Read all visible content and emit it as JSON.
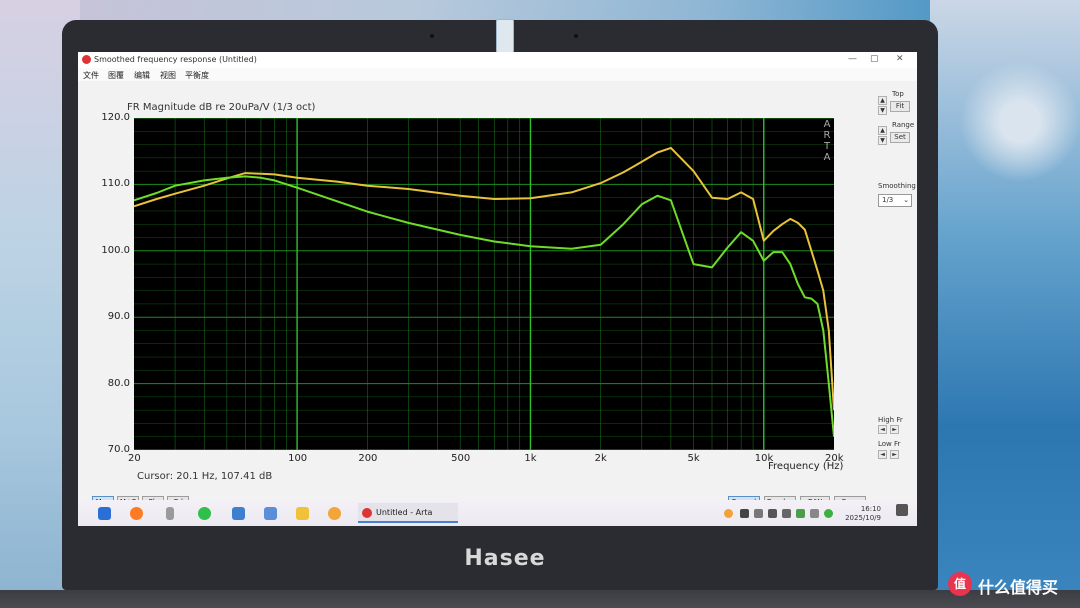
{
  "window": {
    "title": "Smoothed frequency response (Untitled)",
    "minimize_glyph": "—",
    "maximize_glyph": "▢",
    "close_glyph": "✕"
  },
  "menu": [
    "文件",
    "图覆",
    "编辑",
    "视图",
    "平衡度"
  ],
  "chart_data": {
    "type": "line",
    "title": "FR Magnitude dB re 20uPa/V (1/3 oct)",
    "xlabel": "Frequency (Hz)",
    "ylabel": "",
    "x_scale": "log",
    "xlim": [
      20,
      20000
    ],
    "ylim": [
      70,
      120
    ],
    "grid": true,
    "background": "#000000",
    "grid_color": "#1f8c1f",
    "x_tick_labels": [
      "20",
      "100",
      "200",
      "500",
      "1k",
      "2k",
      "5k",
      "10k",
      "20k"
    ],
    "x_tick_values": [
      20,
      100,
      200,
      500,
      1000,
      2000,
      5000,
      10000,
      20000
    ],
    "y_tick_labels": [
      "120.0",
      "110.0",
      "100.0",
      "90.0",
      "80.0",
      "70.0"
    ],
    "y_tick_values": [
      120,
      110,
      100,
      90,
      80,
      70
    ],
    "series": [
      {
        "color": "#e8c23a",
        "x": [
          20,
          25,
          30,
          40,
          50,
          60,
          70,
          80,
          100,
          150,
          200,
          300,
          500,
          700,
          1000,
          1500,
          2000,
          2500,
          3000,
          3500,
          4000,
          5000,
          6000,
          7000,
          8000,
          9000,
          10000,
          11000,
          12000,
          13000,
          14000,
          15000,
          16000,
          17000,
          18000,
          19000,
          20000
        ],
        "y": [
          106.7,
          107.8,
          108.6,
          109.8,
          110.9,
          111.7,
          111.6,
          111.5,
          111.0,
          110.4,
          109.8,
          109.3,
          108.3,
          107.8,
          107.9,
          108.8,
          110.2,
          111.8,
          113.4,
          114.8,
          115.5,
          112.0,
          108.0,
          107.8,
          108.8,
          107.8,
          101.5,
          103.0,
          104.0,
          104.8,
          104.2,
          103.2,
          100.0,
          97.0,
          94.0,
          88.0,
          76.0
        ]
      },
      {
        "color": "#6fdc2a",
        "x": [
          20,
          25,
          30,
          40,
          50,
          60,
          70,
          80,
          100,
          150,
          200,
          300,
          500,
          700,
          1000,
          1500,
          2000,
          2500,
          3000,
          3500,
          4000,
          5000,
          6000,
          7000,
          8000,
          9000,
          10000,
          11000,
          12000,
          13000,
          14000,
          15000,
          16000,
          17000,
          18000,
          19000,
          20000
        ],
        "y": [
          107.6,
          108.7,
          109.8,
          110.6,
          111.0,
          111.2,
          111.0,
          110.6,
          109.5,
          107.4,
          105.9,
          104.2,
          102.4,
          101.4,
          100.7,
          100.3,
          100.9,
          104.0,
          107.0,
          108.3,
          107.6,
          98.0,
          97.5,
          100.5,
          102.8,
          101.5,
          98.5,
          99.8,
          99.8,
          98.0,
          95.0,
          93.0,
          92.8,
          92.0,
          88.0,
          80.0,
          72.0
        ]
      }
    ]
  },
  "cursor_readout": "Cursor: 20.1 Hz, 107.41 dB",
  "watermark_letters": [
    "A",
    "R",
    "T",
    "A"
  ],
  "side_panel": {
    "top_label": "Top",
    "fit_label": "Fit",
    "range_label": "Range",
    "set_label": "Set",
    "smoothing_label": "Smoothing",
    "smoothing_value": "1/3",
    "high_label": "High Fr",
    "low_label": "Low Fr"
  },
  "bottom_tabs": [
    "Mag",
    "M+P",
    "Ph",
    "Gd"
  ],
  "bottom_buttons": [
    "Record",
    "Overlay",
    "B/W",
    "Copy"
  ],
  "taskbar": {
    "app_label": "Untitled - Arta",
    "time": "16:10",
    "date": "2025/10/9"
  },
  "device": {
    "brand": "Hasee"
  },
  "watermark": {
    "logo": "值",
    "text": "什么值得买"
  },
  "icons": [
    "windows-start-icon",
    "browser-icon",
    "usb-icon",
    "wechat-icon",
    "file-icon",
    "edit-icon",
    "tools-icon",
    "face-icon",
    "arta-icon"
  ]
}
